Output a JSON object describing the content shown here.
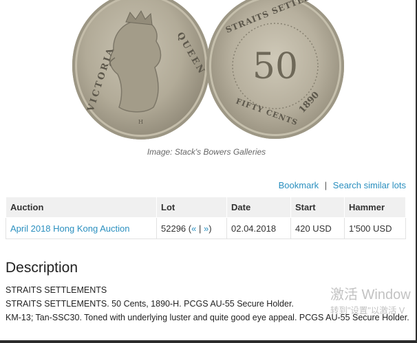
{
  "images": {
    "obverse": {
      "legend_left": "VICTORIA",
      "legend_right": "QUEEN",
      "mint_mark": "H"
    },
    "reverse": {
      "legend_top": "STRAITS SETTLEMENTS",
      "denomination": "50",
      "legend_bottom": "FIFTY CENTS",
      "year": "1890"
    },
    "caption": "Image: Stack's Bowers Galleries"
  },
  "actions": {
    "bookmark": "Bookmark",
    "separator": "|",
    "search_similar": "Search similar lots"
  },
  "lots_table": {
    "headers": [
      "Auction",
      "Lot",
      "Date",
      "Start",
      "Hammer"
    ],
    "row": {
      "auction": "April 2018 Hong Kong Auction",
      "lot": "52296",
      "lot_prev": "«",
      "lot_sep": "|",
      "lot_next": "»",
      "date": "02.04.2018",
      "start": "420 USD",
      "hammer": "1'500 USD"
    }
  },
  "description": {
    "title": "Description",
    "lines": [
      "STRAITS SETTLEMENTS",
      "STRAITS SETTLEMENTS. 50 Cents, 1890-H. PCGS AU-55 Secure Holder.",
      "KM-13; Tan-SSC30. Toned with underlying luster and quite good eye appeal. PCGS AU-55 Secure Holder."
    ]
  },
  "os_watermark": {
    "line1": "激活 Window",
    "line2": "转到\"设置\"以激活 V"
  },
  "colors": {
    "link": "#2a8fbf",
    "table_header_bg": "#f0f0f0"
  }
}
